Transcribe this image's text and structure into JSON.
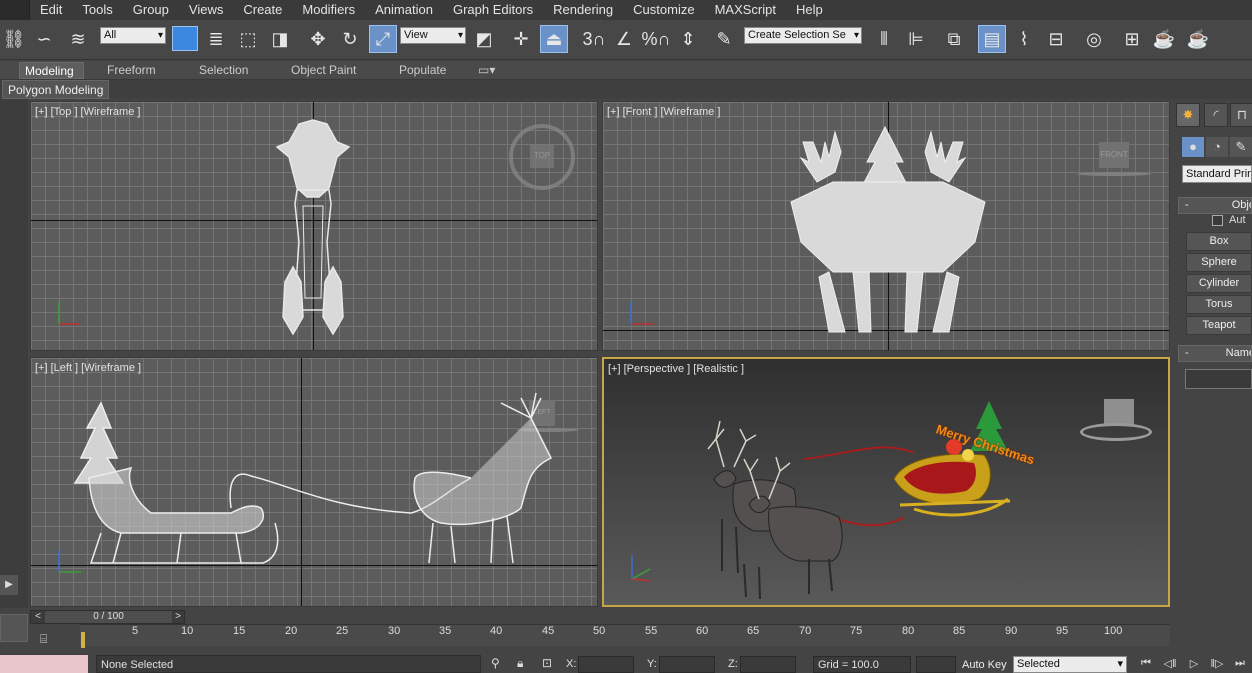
{
  "menu": [
    "Edit",
    "Tools",
    "Group",
    "Views",
    "Create",
    "Modifiers",
    "Animation",
    "Graph Editors",
    "Rendering",
    "Customize",
    "MAXScript",
    "Help"
  ],
  "toolbar": {
    "selection_filter": "All",
    "reference_coord": "View",
    "named_selection": "Create Selection Se",
    "snap_label": "3",
    "percent_label": "%"
  },
  "ribbon": {
    "tabs": [
      "Modeling",
      "Freeform",
      "Selection",
      "Object Paint",
      "Populate"
    ],
    "active_tab": "Modeling",
    "sub_label": "Polygon Modeling"
  },
  "viewports": {
    "top": {
      "label": "[+] [Top ] [Wireframe ]",
      "cube": "TOP"
    },
    "front": {
      "label": "[+] [Front ] [Wireframe ]",
      "cube": "FRONT"
    },
    "left": {
      "label": "[+] [Left ] [Wireframe ]",
      "cube": "LEFT"
    },
    "perspective": {
      "label": "[+] [Perspective ] [Realistic ]",
      "banner": "Merry Christmas"
    }
  },
  "command_panel": {
    "dropdown": "Standard Prim",
    "object_type_title": "Obje",
    "autogrid": "Aut",
    "buttons": [
      "Box",
      "Sphere",
      "Cylinder",
      "Torus",
      "Teapot"
    ],
    "name_title": "Name"
  },
  "timeline": {
    "frame_display": "0 / 100",
    "ticks": [
      "5",
      "10",
      "15",
      "20",
      "25",
      "30",
      "35",
      "40",
      "45",
      "50",
      "55",
      "60",
      "65",
      "70",
      "75",
      "80",
      "85",
      "90",
      "95",
      "100"
    ]
  },
  "status": {
    "selection": "None Selected",
    "x_label": "X:",
    "y_label": "Y:",
    "z_label": "Z:",
    "grid": "Grid = 100.0",
    "auto_key": "Auto Key",
    "key_mode": "Selected"
  },
  "colors": {
    "active_blue": "#3c87e0",
    "active_viewport_border": "#c7a64a",
    "auto_key_pink": "#e9c6cc"
  }
}
